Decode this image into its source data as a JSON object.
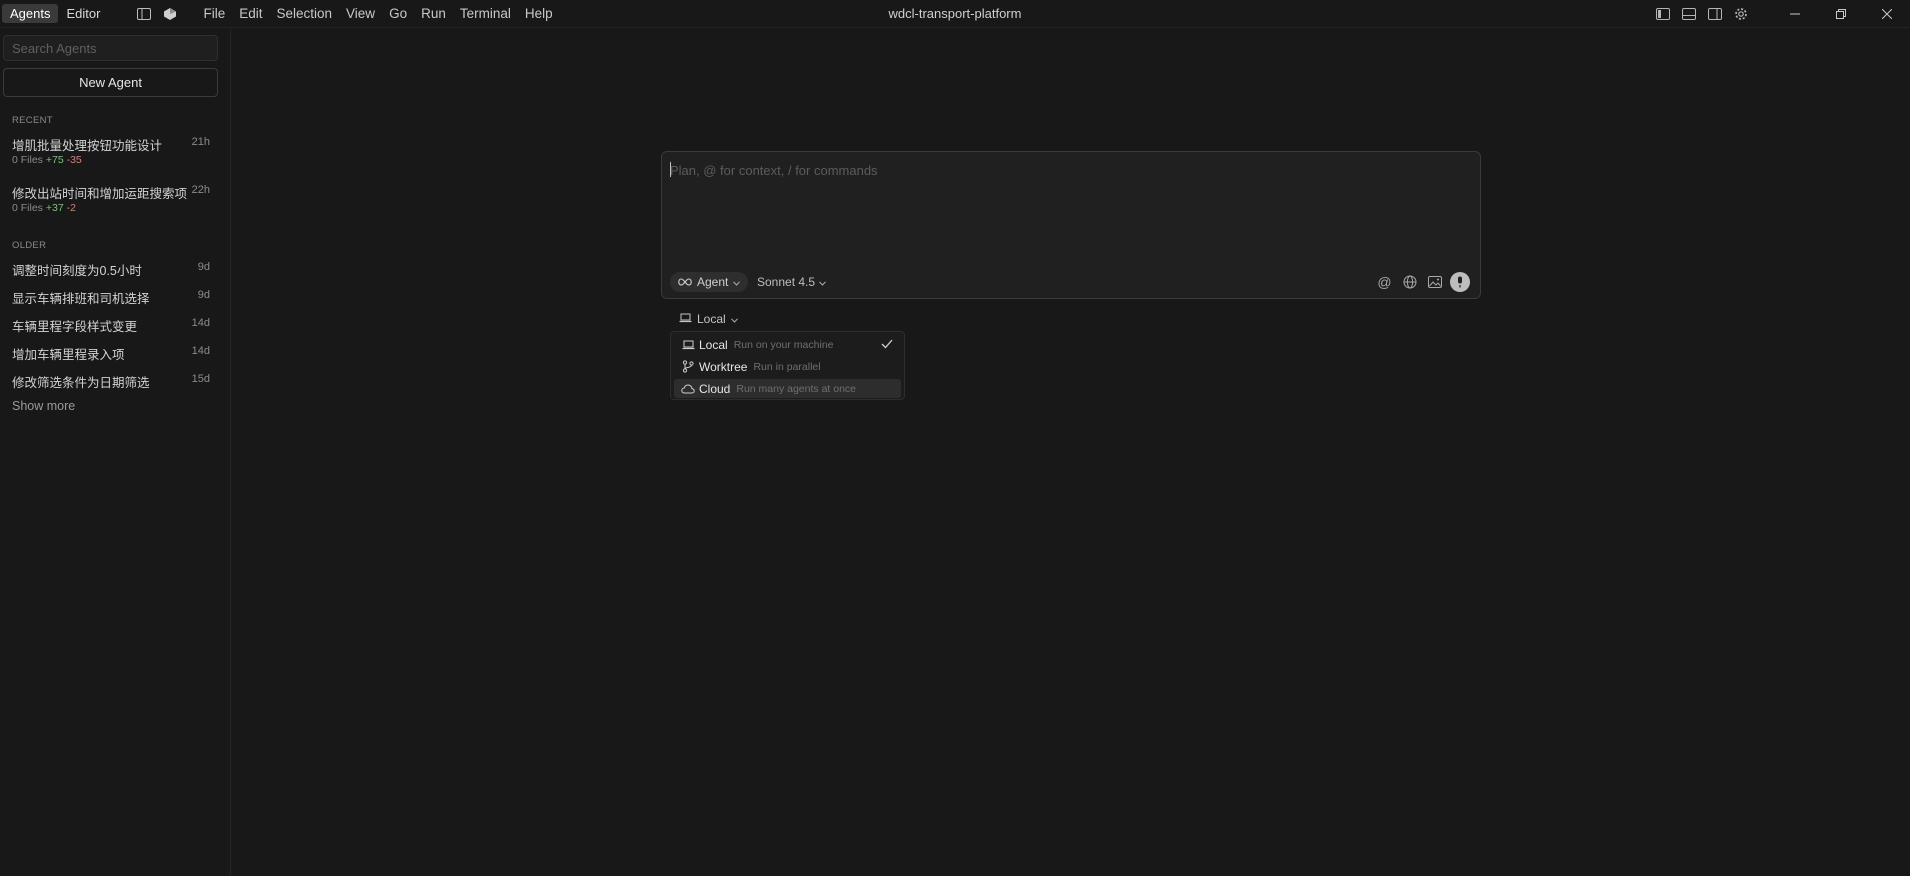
{
  "titlebar": {
    "modes": [
      "Agents",
      "Editor"
    ],
    "menu": [
      "File",
      "Edit",
      "Selection",
      "View",
      "Go",
      "Run",
      "Terminal",
      "Help"
    ],
    "window_title": "wdcl-transport-platform"
  },
  "sidebar": {
    "search_placeholder": "Search Agents",
    "new_agent_label": "New Agent",
    "recent_label": "RECENT",
    "older_label": "OLDER",
    "recent": [
      {
        "title": "增肌批量处理按钮功能设计",
        "time": "21h",
        "files": "0 Files",
        "plus": "+75",
        "minus": "-35"
      },
      {
        "title": "修改出站时间和增加运距搜索项",
        "time": "22h",
        "files": "0 Files",
        "plus": "+37",
        "minus": "-2"
      }
    ],
    "older": [
      {
        "title": "调整时间刻度为0.5小时",
        "time": "9d"
      },
      {
        "title": "显示车辆排班和司机选择",
        "time": "9d"
      },
      {
        "title": "车辆里程字段样式变更",
        "time": "14d"
      },
      {
        "title": "增加车辆里程录入项",
        "time": "14d"
      },
      {
        "title": "修改筛选条件为日期筛选",
        "time": "15d"
      }
    ],
    "show_more": "Show more"
  },
  "composer": {
    "placeholder": "Plan, @ for context, / for commands",
    "agent_label": "Agent",
    "model_label": "Sonnet 4.5",
    "icons": [
      "at-icon",
      "globe-icon",
      "image-icon",
      "microphone-icon"
    ]
  },
  "environment": {
    "selected": "Local",
    "options": [
      {
        "label": "Local",
        "desc": "Run on your machine",
        "icon": "laptop-icon",
        "checked": true
      },
      {
        "label": "Worktree",
        "desc": "Run in parallel",
        "icon": "branch-icon",
        "checked": false
      },
      {
        "label": "Cloud",
        "desc": "Run many agents at once",
        "icon": "cloud-icon",
        "checked": false
      }
    ]
  },
  "colors": {
    "background": "#181818",
    "panel": "#202020",
    "plus": "#7fbf7f",
    "minus": "#e07b7b"
  }
}
